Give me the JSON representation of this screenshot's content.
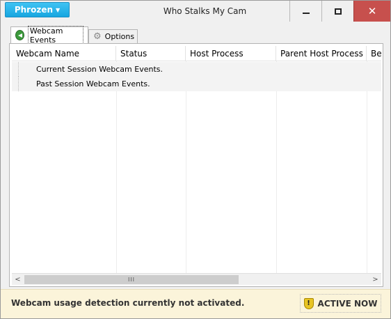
{
  "window": {
    "title": "Who Stalks My Cam",
    "brand_label": "Phrozen",
    "brand_caret": "▼",
    "close_glyph": "✕"
  },
  "tabs": [
    {
      "label": "Webcam Events",
      "icon": "back-arrow-icon",
      "selected": true
    },
    {
      "label": "Options",
      "icon": "gear-icon",
      "selected": false
    }
  ],
  "list": {
    "columns": [
      {
        "label": "Webcam Name"
      },
      {
        "label": "Status"
      },
      {
        "label": "Host Process"
      },
      {
        "label": "Parent Host Process"
      },
      {
        "label": "Be"
      }
    ],
    "groups": [
      {
        "label": "Current Session Webcam Events."
      },
      {
        "label": "Past Session Webcam Events."
      }
    ]
  },
  "scrollbar": {
    "thumb_grip": "III"
  },
  "status_bar": {
    "message": "Webcam usage detection currently not activated.",
    "action_label": "ACTIVE NOW",
    "action_icon": "shield-icon",
    "accent_color": "#fbf4da"
  },
  "colors": {
    "brand": "#17a6e0",
    "close_button": "#c7504d"
  }
}
